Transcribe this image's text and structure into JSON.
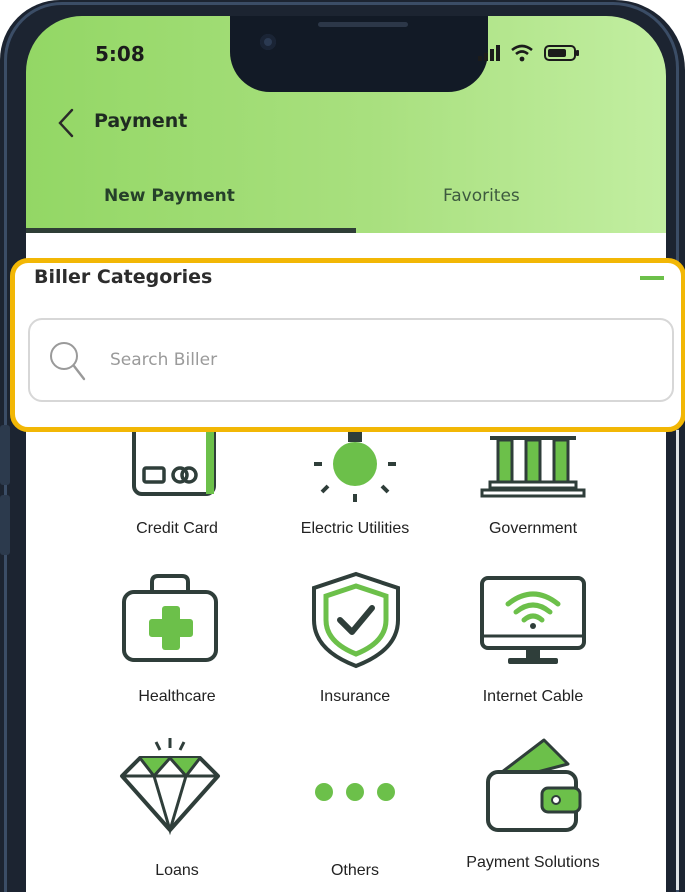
{
  "status_bar": {
    "time": "5:08"
  },
  "header": {
    "title": "Payment"
  },
  "tabs": [
    {
      "label": "New Payment",
      "selected": true
    },
    {
      "label": "Favorites",
      "selected": false
    }
  ],
  "biller_section": {
    "title": "Biller Categories",
    "search_placeholder": "Search Biller"
  },
  "categories": [
    {
      "label": "Credit Card",
      "icon": "credit-card-icon"
    },
    {
      "label": "Electric Utilities",
      "icon": "lightbulb-icon"
    },
    {
      "label": "Government",
      "icon": "government-building-icon"
    },
    {
      "label": "Healthcare",
      "icon": "medical-kit-icon"
    },
    {
      "label": "Insurance",
      "icon": "shield-check-icon"
    },
    {
      "label": "Internet Cable",
      "icon": "monitor-wifi-icon"
    },
    {
      "label": "Loans",
      "icon": "diamond-icon"
    },
    {
      "label": "Others",
      "icon": "more-dots-icon"
    },
    {
      "label": "Payment Solutions",
      "icon": "wallet-icon"
    }
  ],
  "colors": {
    "accent_green": "#6cc04a",
    "header_gradient_start": "#93d765",
    "header_gradient_end": "#c2eea1",
    "highlight": "#f2b705",
    "icon_stroke": "#2f3e3a"
  }
}
